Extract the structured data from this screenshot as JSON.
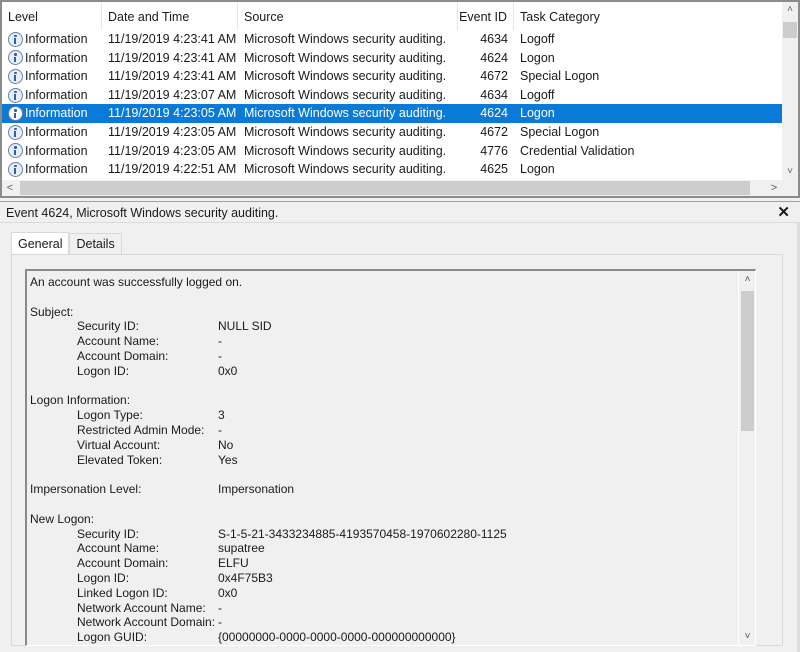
{
  "event_list": {
    "columns": {
      "level": "Level",
      "date_time": "Date and Time",
      "source": "Source",
      "event_id": "Event ID",
      "task_category": "Task Category"
    },
    "rows": [
      {
        "level": "Information",
        "date_time": "11/19/2019 4:23:41 AM",
        "source": "Microsoft Windows security auditing.",
        "event_id": "4634",
        "task_category": "Logoff",
        "icon": "information-icon"
      },
      {
        "level": "Information",
        "date_time": "11/19/2019 4:23:41 AM",
        "source": "Microsoft Windows security auditing.",
        "event_id": "4624",
        "task_category": "Logon",
        "icon": "information-icon"
      },
      {
        "level": "Information",
        "date_time": "11/19/2019 4:23:41 AM",
        "source": "Microsoft Windows security auditing.",
        "event_id": "4672",
        "task_category": "Special Logon",
        "icon": "information-icon"
      },
      {
        "level": "Information",
        "date_time": "11/19/2019 4:23:07 AM",
        "source": "Microsoft Windows security auditing.",
        "event_id": "4634",
        "task_category": "Logoff",
        "icon": "information-icon"
      },
      {
        "level": "Information",
        "date_time": "11/19/2019 4:23:05 AM",
        "source": "Microsoft Windows security auditing.",
        "event_id": "4624",
        "task_category": "Logon",
        "icon": "information-icon",
        "selected": true
      },
      {
        "level": "Information",
        "date_time": "11/19/2019 4:23:05 AM",
        "source": "Microsoft Windows security auditing.",
        "event_id": "4672",
        "task_category": "Special Logon",
        "icon": "information-icon"
      },
      {
        "level": "Information",
        "date_time": "11/19/2019 4:23:05 AM",
        "source": "Microsoft Windows security auditing.",
        "event_id": "4776",
        "task_category": "Credential Validation",
        "icon": "information-icon"
      },
      {
        "level": "Information",
        "date_time": "11/19/2019 4:22:51 AM",
        "source": "Microsoft Windows security auditing.",
        "event_id": "4625",
        "task_category": "Logon",
        "icon": "information-icon"
      }
    ],
    "selected_row_color": "#0a7ad9",
    "scroll": {
      "up": "˄",
      "down": "˅",
      "left": "<",
      "right": ">"
    }
  },
  "detail": {
    "title": "Event 4624, Microsoft Windows security auditing.",
    "close_glyph": "✕",
    "tabs": [
      {
        "label": "General",
        "active": true
      },
      {
        "label": "Details",
        "active": false
      }
    ],
    "message": {
      "lines": [
        {
          "key": "An account was successfully logged on.",
          "value": "",
          "indent": false
        },
        {
          "blank": true
        },
        {
          "key": "Subject:",
          "value": "",
          "indent": false
        },
        {
          "key": "Security ID:",
          "value": "NULL SID",
          "indent": true
        },
        {
          "key": "Account Name:",
          "value": "-",
          "indent": true
        },
        {
          "key": "Account Domain:",
          "value": "-",
          "indent": true
        },
        {
          "key": "Logon ID:",
          "value": "0x0",
          "indent": true
        },
        {
          "blank": true
        },
        {
          "key": "Logon Information:",
          "value": "",
          "indent": false
        },
        {
          "key": "Logon Type:",
          "value": "3",
          "indent": true
        },
        {
          "key": "Restricted Admin Mode:",
          "value": "-",
          "indent": true
        },
        {
          "key": "Virtual Account:",
          "value": "No",
          "indent": true
        },
        {
          "key": "Elevated Token:",
          "value": "Yes",
          "indent": true
        },
        {
          "blank": true
        },
        {
          "key": "Impersonation Level:",
          "value": "Impersonation",
          "indent": false
        },
        {
          "blank": true
        },
        {
          "key": "New Logon:",
          "value": "",
          "indent": false
        },
        {
          "key": "Security ID:",
          "value": "S-1-5-21-3433234885-4193570458-1970602280-1125",
          "indent": true
        },
        {
          "key": "Account Name:",
          "value": "supatree",
          "indent": true
        },
        {
          "key": "Account Domain:",
          "value": "ELFU",
          "indent": true
        },
        {
          "key": "Logon ID:",
          "value": "0x4F75B3",
          "indent": true
        },
        {
          "key": "Linked Logon ID:",
          "value": "0x0",
          "indent": true
        },
        {
          "key": "Network Account Name:",
          "value": "-",
          "indent": true
        },
        {
          "key": "Network Account Domain:",
          "value": "-",
          "indent": true
        },
        {
          "key": "Logon GUID:",
          "value": "{00000000-0000-0000-0000-000000000000}",
          "indent": true
        }
      ]
    },
    "scroll": {
      "up": "˄",
      "down": "˅"
    }
  }
}
